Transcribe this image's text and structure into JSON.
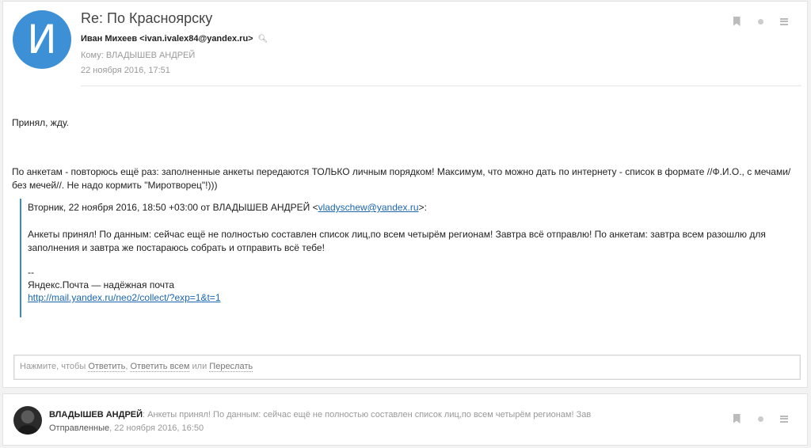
{
  "message": {
    "avatar_letter": "И",
    "subject": "Re: По Красноярску",
    "from": "Иван Михеев <ivan.ivalex84@yandex.ru>",
    "to": "Кому: ВЛАДЫШЕВ АНДРЕЙ",
    "date": "22 ноября 2016, 17:51",
    "body_line1": "Принял, жду.",
    "body_line2": "По анкетам - повторюсь ещё раз: заполненные анкеты передаются ТОЛЬКО личным порядком! Максимум, что можно дать по интернету - список в формате //Ф.И.О., с мечами/без мечей//. Не надо кормить \"Миротворец\"!)))",
    "quote": {
      "header_prefix": "Вторник, 22 ноября 2016, 18:50 +03:00 от ВЛАДЫШЕВ АНДРЕЙ <",
      "header_email": "vladyschew@yandex.ru",
      "header_suffix": ">:",
      "text": "Анкеты принял! По данным: сейчас ещё не полностью составлен список лиц,по всем четырём регионам! Завтра всё отправлю! По анкетам: завтра всем разошлю для заполнения и завтра же постараюсь собрать и отправить всё тебе!",
      "sig_dash": "--",
      "sig_text": "Яндекс.Почта — надёжная почта",
      "sig_link": "http://mail.yandex.ru/neo2/collect/?exp=1&t=1"
    }
  },
  "reply": {
    "prefix": "Нажмите, чтобы",
    "reply_label": "Ответить",
    "sep": ",",
    "reply_all_label": "Ответить всем",
    "or": "или",
    "forward_label": "Переслать"
  },
  "thread": {
    "sender": "ВЛАДЫШЕВ АНДРЕЙ",
    "snippet": ": Анкеты принял! По данным: сейчас ещё не полностью составлен список лиц,по всем четырём регионам! Зав",
    "folder": "Отправленные",
    "date": ", 22 ноября 2016, 16:50"
  },
  "icons": {
    "bookmark": "bookmark-icon",
    "dot": "mark-read-icon",
    "menu": "more-menu-icon",
    "search": "search-icon"
  }
}
